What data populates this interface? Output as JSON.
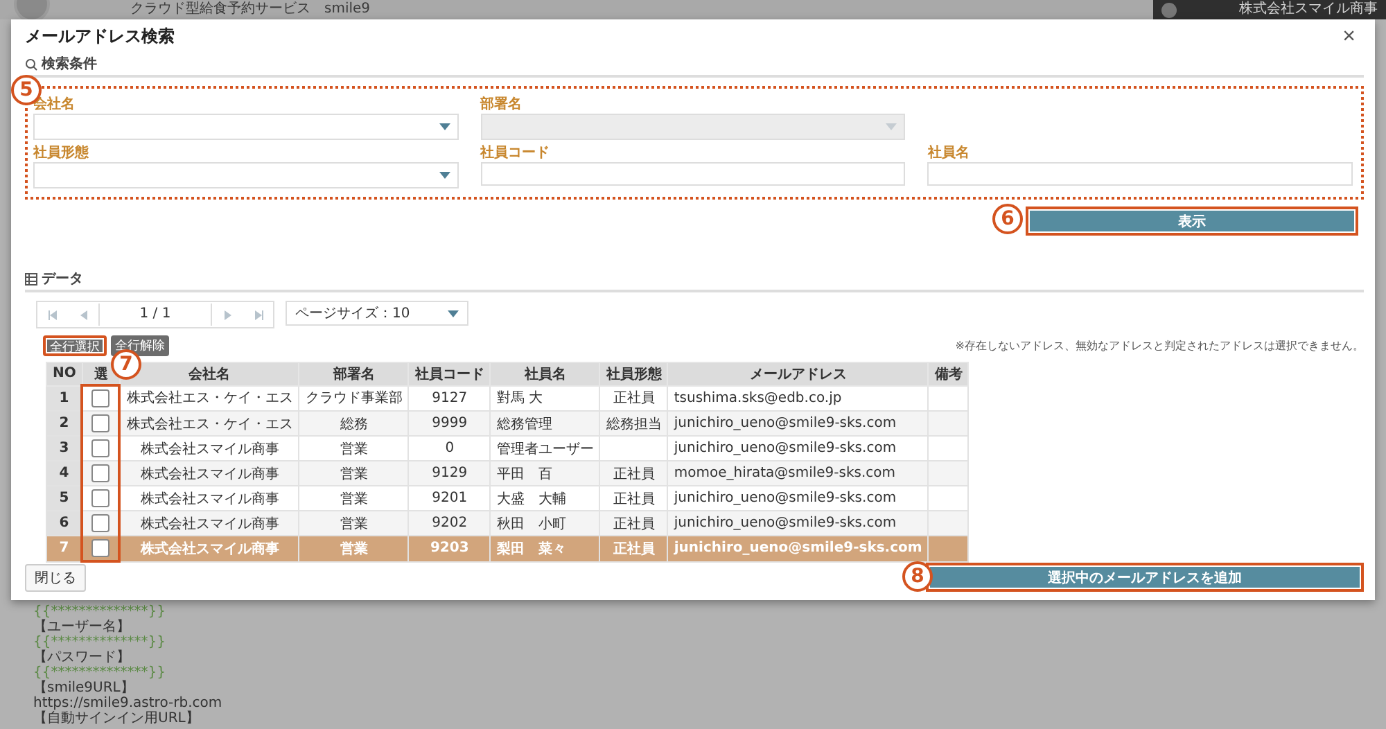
{
  "app_header": {
    "title": "クラウド型給食予約サービス　smile9",
    "company": "株式会社スマイル商事"
  },
  "background_lines": [
    {
      "kind": "mask",
      "text": "{{**************}}"
    },
    {
      "kind": "text",
      "text": "【ユーザー名】"
    },
    {
      "kind": "mask",
      "text": "{{**************}}"
    },
    {
      "kind": "text",
      "text": "【パスワード】"
    },
    {
      "kind": "mask",
      "text": "{{**************}}"
    },
    {
      "kind": "text",
      "text": "【smile9URL】"
    },
    {
      "kind": "text",
      "text": "https://smile9.astro-rb.com"
    },
    {
      "kind": "text",
      "text": "【自動サインイン用URL】"
    }
  ],
  "dialog": {
    "title": "メールアドレス検索",
    "close": "×"
  },
  "search": {
    "heading": "検索条件",
    "highlighted": true,
    "callout": "5",
    "fields": [
      {
        "label": "会社名",
        "kind": "select"
      },
      {
        "label": "部署名",
        "kind": "select",
        "disabled": true
      },
      {
        "kind": "spacer"
      },
      {
        "label": "社員形態",
        "kind": "select"
      },
      {
        "label": "社員コード",
        "kind": "text"
      },
      {
        "label": "社員名",
        "kind": "text"
      }
    ],
    "show_button": {
      "label": "表示",
      "highlighted": true,
      "callout": "6"
    }
  },
  "data": {
    "heading": "データ",
    "pager": {
      "page": "1 / 1",
      "page_size": "ページサイズ：10"
    },
    "select_all": {
      "label": "全行選択",
      "highlighted": true
    },
    "deselect_all": {
      "label": "全行解除",
      "highlighted": false
    },
    "note": "※存在しないアドレス、無効なアドレスと判定されたアドレスは選択できません。",
    "table": {
      "select_callout": "7",
      "select_highlighted": true,
      "columns": [
        "NO",
        "選",
        "会社名",
        "部署名",
        "社員コード",
        "社員名",
        "社員形態",
        "メールアドレス",
        "備考"
      ],
      "rows": [
        {
          "no": "1",
          "checked": false,
          "selected": false,
          "company": "株式会社エス・ケイ・エス",
          "dept": "クラウド事業部",
          "code": "9127",
          "name": "對馬 大",
          "type": "正社員",
          "email": "tsushima.sks@edb.co.jp"
        },
        {
          "no": "2",
          "checked": false,
          "selected": false,
          "company": "株式会社エス・ケイ・エス",
          "dept": "総務",
          "code": "9999",
          "name": "総務管理",
          "type": "総務担当",
          "email": "junichiro_ueno@smile9-sks.com"
        },
        {
          "no": "3",
          "checked": false,
          "selected": false,
          "company": "株式会社スマイル商事",
          "dept": "営業",
          "code": "0",
          "name": "管理者ユーザー",
          "type": "",
          "email": "junichiro_ueno@smile9-sks.com"
        },
        {
          "no": "4",
          "checked": false,
          "selected": false,
          "company": "株式会社スマイル商事",
          "dept": "営業",
          "code": "9129",
          "name": "平田　百",
          "type": "正社員",
          "email": "momoe_hirata@smile9-sks.com"
        },
        {
          "no": "5",
          "checked": false,
          "selected": false,
          "company": "株式会社スマイル商事",
          "dept": "営業",
          "code": "9201",
          "name": "大盛　大輔",
          "type": "正社員",
          "email": "junichiro_ueno@smile9-sks.com"
        },
        {
          "no": "6",
          "checked": false,
          "selected": false,
          "company": "株式会社スマイル商事",
          "dept": "営業",
          "code": "9202",
          "name": "秋田　小町",
          "type": "正社員",
          "email": "junichiro_ueno@smile9-sks.com"
        },
        {
          "no": "7",
          "checked": false,
          "selected": true,
          "company": "株式会社スマイル商事",
          "dept": "営業",
          "code": "9203",
          "name": "梨田　菜々",
          "type": "正社員",
          "email": "junichiro_ueno@smile9-sks.com"
        }
      ]
    }
  },
  "footer": {
    "close": "閉じる",
    "add": {
      "label": "選択中のメールアドレスを追加",
      "highlighted": true,
      "callout": "8"
    }
  }
}
